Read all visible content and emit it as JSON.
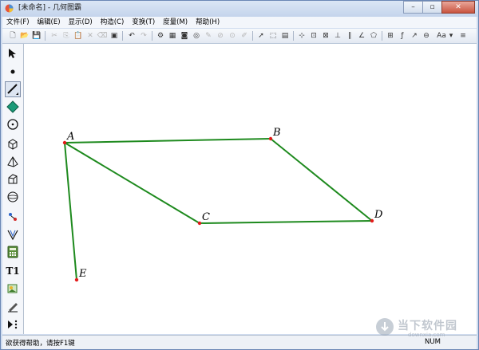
{
  "window": {
    "title": "[未命名] - 几何图霸",
    "min_label": "–",
    "max_label": "▫",
    "close_label": "✕"
  },
  "menu": [
    {
      "label": "文件(F)"
    },
    {
      "label": "编辑(E)"
    },
    {
      "label": "显示(D)"
    },
    {
      "label": "构造(C)"
    },
    {
      "label": "变换(T)"
    },
    {
      "label": "度量(M)"
    },
    {
      "label": "帮助(H)"
    }
  ],
  "toolbar": {
    "text_format_label": "Aa"
  },
  "toolbox": {
    "text_tool_label": "T1"
  },
  "drawing": {
    "line_color": "#1e8a1e",
    "point_color": "#e31b1b",
    "points": [
      {
        "name": "A"
      },
      {
        "name": "B"
      },
      {
        "name": "C"
      },
      {
        "name": "D"
      },
      {
        "name": "E"
      }
    ],
    "segments": [
      [
        "A",
        "B"
      ],
      [
        "B",
        "D"
      ],
      [
        "C",
        "D"
      ],
      [
        "A",
        "C"
      ],
      [
        "A",
        "E"
      ]
    ]
  },
  "status": {
    "help_text": "欲获得帮助，请按F1键",
    "num_indicator": "NUM"
  },
  "watermark": {
    "title": "当下软件园",
    "url": "downxia.com"
  }
}
